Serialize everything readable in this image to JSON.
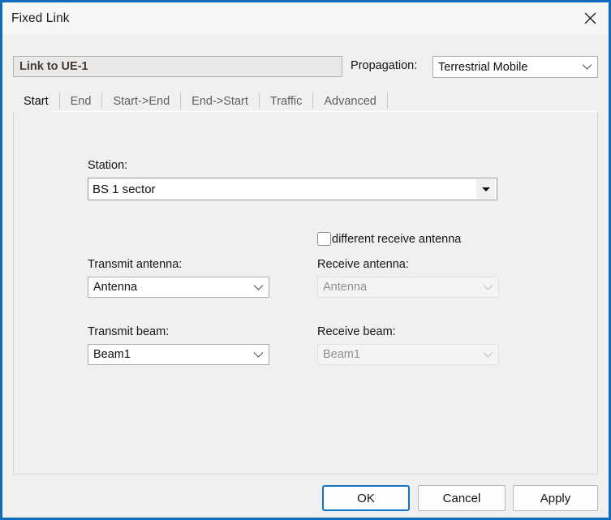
{
  "window": {
    "title": "Fixed Link",
    "accent_color": "#0f6cbd",
    "background_color": "#f0f0f0",
    "close_icon": "close-icon"
  },
  "header": {
    "link_name": "Link to UE-1",
    "propagation_label": "Propagation:",
    "propagation_value": "Terrestrial Mobile",
    "propagation_options": [
      "Terrestrial Mobile"
    ],
    "chevron_icon": "chevron-down-icon"
  },
  "tabs": [
    {
      "label": "Start",
      "active": true
    },
    {
      "label": "End",
      "active": false
    },
    {
      "label": "Start->End",
      "active": false
    },
    {
      "label": "End->Start",
      "active": false
    },
    {
      "label": "Traffic",
      "active": false
    },
    {
      "label": "Advanced",
      "active": false
    }
  ],
  "form": {
    "station_label": "Station:",
    "station_value": "BS 1 sector",
    "station_options": [
      "BS 1 sector"
    ],
    "different_receive_antenna_label": "different receive antenna",
    "different_receive_antenna_checked": false,
    "transmit_antenna_label": "Transmit antenna:",
    "transmit_antenna_value": "Antenna",
    "receive_antenna_label": "Receive antenna:",
    "receive_antenna_value": "Antenna",
    "receive_antenna_disabled": true,
    "transmit_beam_label": "Transmit beam:",
    "transmit_beam_value": "Beam1",
    "receive_beam_label": "Receive beam:",
    "receive_beam_value": "Beam1",
    "receive_beam_disabled": true
  },
  "footer": {
    "ok_label": "OK",
    "cancel_label": "Cancel",
    "apply_label": "Apply",
    "default_button": "OK"
  }
}
